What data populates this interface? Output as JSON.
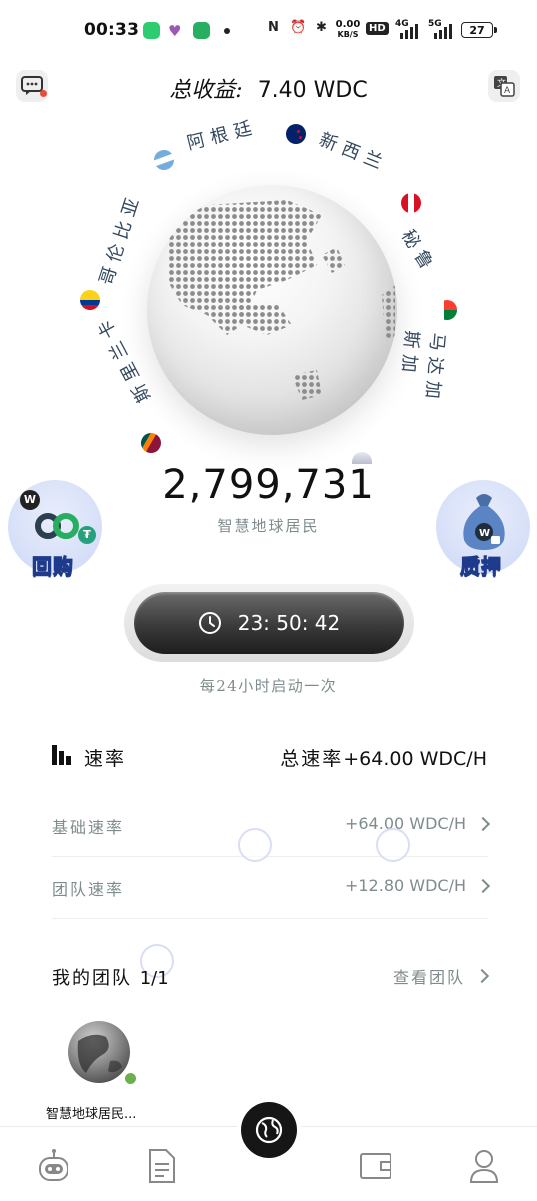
{
  "status_bar": {
    "time": "00:33",
    "net_speed_value": "0.00",
    "net_speed_unit": "KB/S",
    "hd_badge": "HD",
    "signal_4g": "4G",
    "signal_5g": "5G",
    "battery": "27"
  },
  "header": {
    "total_label": "总收益:",
    "total_value": "7.40 WDC",
    "left_icon": "message-icon",
    "right_icon": "translate-icon"
  },
  "globe": {
    "countries": [
      {
        "name": "阿根廷",
        "flag": "argentina-flag-icon"
      },
      {
        "name": "新西兰",
        "flag": "new-zealand-flag-icon"
      },
      {
        "name": "秘鲁",
        "flag": "peru-flag-icon"
      },
      {
        "name": "马达加斯加",
        "flag": "madagascar-flag-icon"
      },
      {
        "name": "哥伦比亚",
        "flag": "colombia-flag-icon"
      },
      {
        "name": "斯里兰卡",
        "flag": "sri-lanka-flag-icon"
      }
    ],
    "population": "2,799,731",
    "population_label": "智慧地球居民"
  },
  "side_buttons": {
    "buyback_label": "回购",
    "pledge_label": "质押",
    "coin_letter": "W"
  },
  "timer": {
    "countdown": "23: 50: 42",
    "note": "每24小时启动一次"
  },
  "rates": {
    "title": "速率",
    "total_label": "总速率",
    "total_value": "+64.00 WDC/H",
    "rows": [
      {
        "label": "基础速率",
        "value": "+64.00 WDC/H"
      },
      {
        "label": "团队速率",
        "value": "+12.80 WDC/H"
      }
    ]
  },
  "team": {
    "title": "我的团队",
    "count": "1/1",
    "view_label": "查看团队",
    "members": [
      {
        "name": "智慧地球居民..."
      }
    ]
  },
  "nav": {
    "items": [
      "robot-icon",
      "document-icon",
      "globe-icon",
      "wallet-icon",
      "profile-icon"
    ],
    "accent": "#161616"
  }
}
